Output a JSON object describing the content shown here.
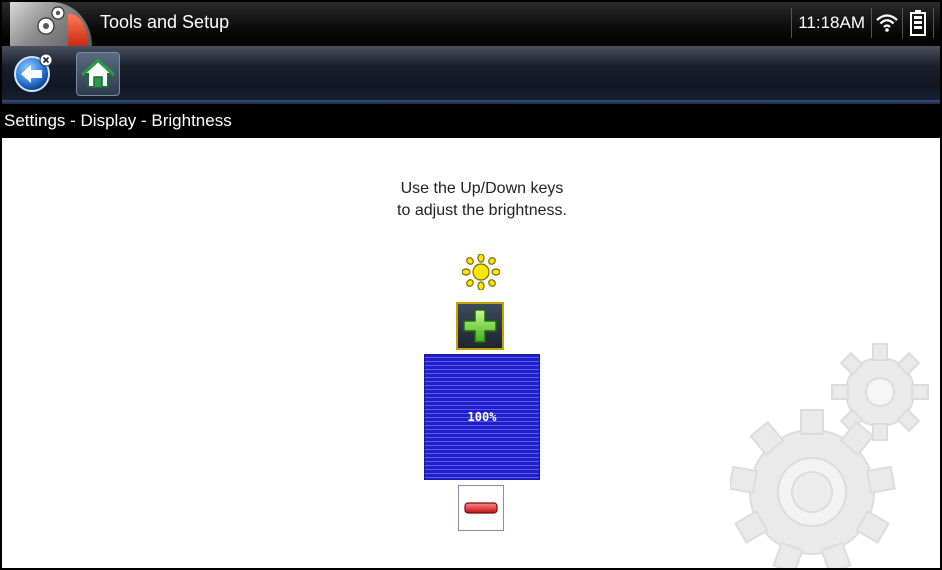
{
  "titlebar": {
    "title": "Tools and Setup",
    "time": "11:18AM",
    "app_icon": "tools-gear-icon",
    "wifi_icon": "wifi-icon",
    "battery_icon": "battery-icon"
  },
  "toolbar": {
    "back_icon": "back-arrow-icon",
    "home_icon": "home-icon"
  },
  "breadcrumb": "Settings - Display - Brightness",
  "main": {
    "instructions_line1": "Use the Up/Down keys",
    "instructions_line2": "to adjust the brightness.",
    "brightness_icon": "sun-icon",
    "increase_icon": "plus-icon",
    "decrease_icon": "minus-icon",
    "brightness_level": "100%",
    "brightness_fraction": 1.0
  },
  "colors": {
    "bar": "#2020c8",
    "bar_stripe": "#5a5aff",
    "plus_green": "#7ddc3c",
    "minus_red": "#e02020",
    "highlight": "#c8a200"
  }
}
